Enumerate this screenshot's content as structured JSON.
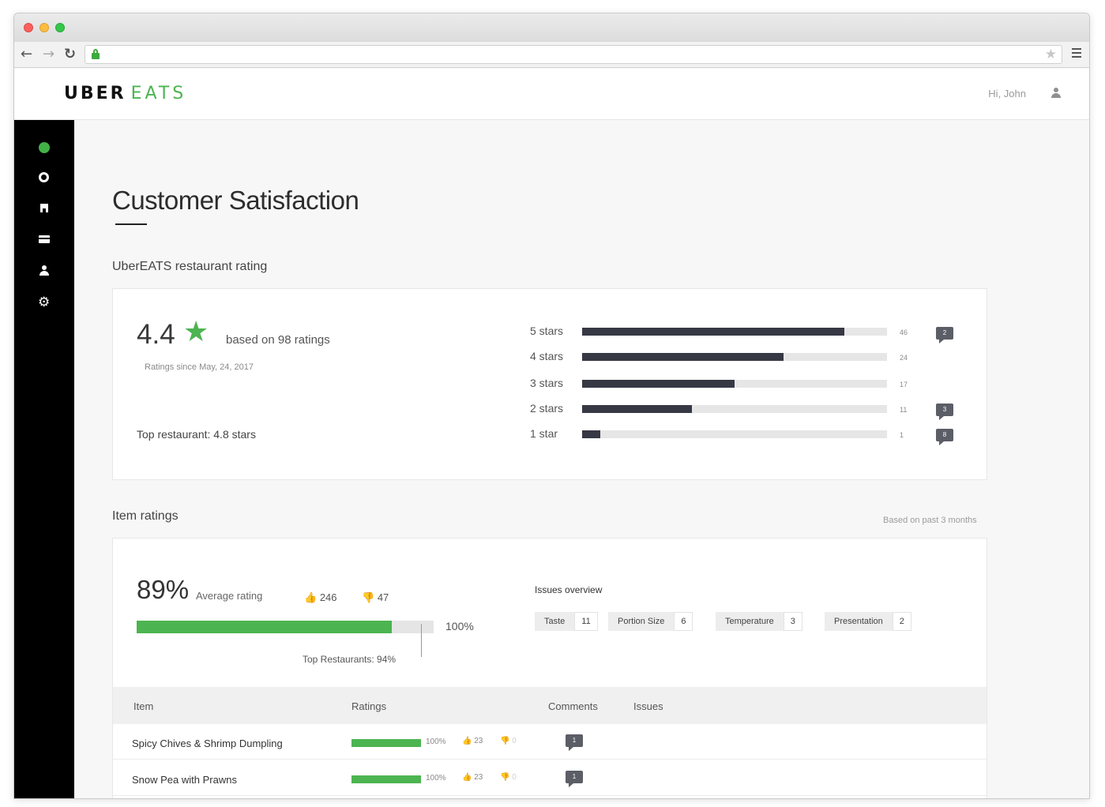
{
  "header": {
    "logo_uber": "UBER",
    "logo_eats": "EATS",
    "greeting": "Hi, John"
  },
  "sidebar": {
    "items": [
      {
        "icon": "dashboard-icon",
        "active": true
      },
      {
        "icon": "eye-icon"
      },
      {
        "icon": "restaurant-icon"
      },
      {
        "icon": "payment-card-icon"
      },
      {
        "icon": "user-icon"
      },
      {
        "icon": "gear-icon"
      }
    ]
  },
  "page": {
    "title": "Customer Satisfaction"
  },
  "restaurant_rating": {
    "section_label": "UberEATS restaurant rating",
    "rating": "4.4",
    "star": "★",
    "based_on": "based on 98 ratings",
    "since": "Ratings since May, 24, 2017",
    "top_restaurant": "Top restaurant: 4.8 stars",
    "distribution": [
      {
        "label": "5 stars",
        "count": "46",
        "fill": 0.86,
        "comments": "2"
      },
      {
        "label": "4 stars",
        "count": "24",
        "fill": 0.66,
        "comments": null
      },
      {
        "label": "3 stars",
        "count": "17",
        "fill": 0.5,
        "comments": null
      },
      {
        "label": "2 stars",
        "count": "11",
        "fill": 0.36,
        "comments": "3"
      },
      {
        "label": "1 star",
        "count": "1",
        "fill": 0.06,
        "comments": "8"
      }
    ]
  },
  "item_ratings": {
    "section_label": "Item ratings",
    "note": "Based on past 3 months",
    "avg_pct": "89%",
    "avg_label": "Average rating",
    "avg_fill": 0.86,
    "thumbs_up": "246",
    "thumbs_down": "47",
    "max_label": "100%",
    "top_restaurants": "Top Restaurants: 94%",
    "issues_title": "Issues overview",
    "issues": [
      {
        "name": "Taste",
        "count": "11"
      },
      {
        "name": "Portion Size",
        "count": "6"
      },
      {
        "name": "Temperature",
        "count": "3"
      },
      {
        "name": "Presentation",
        "count": "2"
      }
    ],
    "table": {
      "headers": {
        "item": "Item",
        "ratings": "Ratings",
        "comments": "Comments",
        "issues": "Issues"
      },
      "rows": [
        {
          "name": "Spicy Chives & Shrimp Dumpling",
          "pct": "100%",
          "fill": 1.0,
          "up": "23",
          "down": "0",
          "comments": "1"
        },
        {
          "name": "Snow Pea with Prawns",
          "pct": "100%",
          "fill": 1.0,
          "up": "23",
          "down": "0",
          "comments": "1"
        }
      ]
    }
  },
  "colors": {
    "accent": "#4cb450",
    "bar_dark": "#363844",
    "sidebar_bg": "#000000"
  }
}
